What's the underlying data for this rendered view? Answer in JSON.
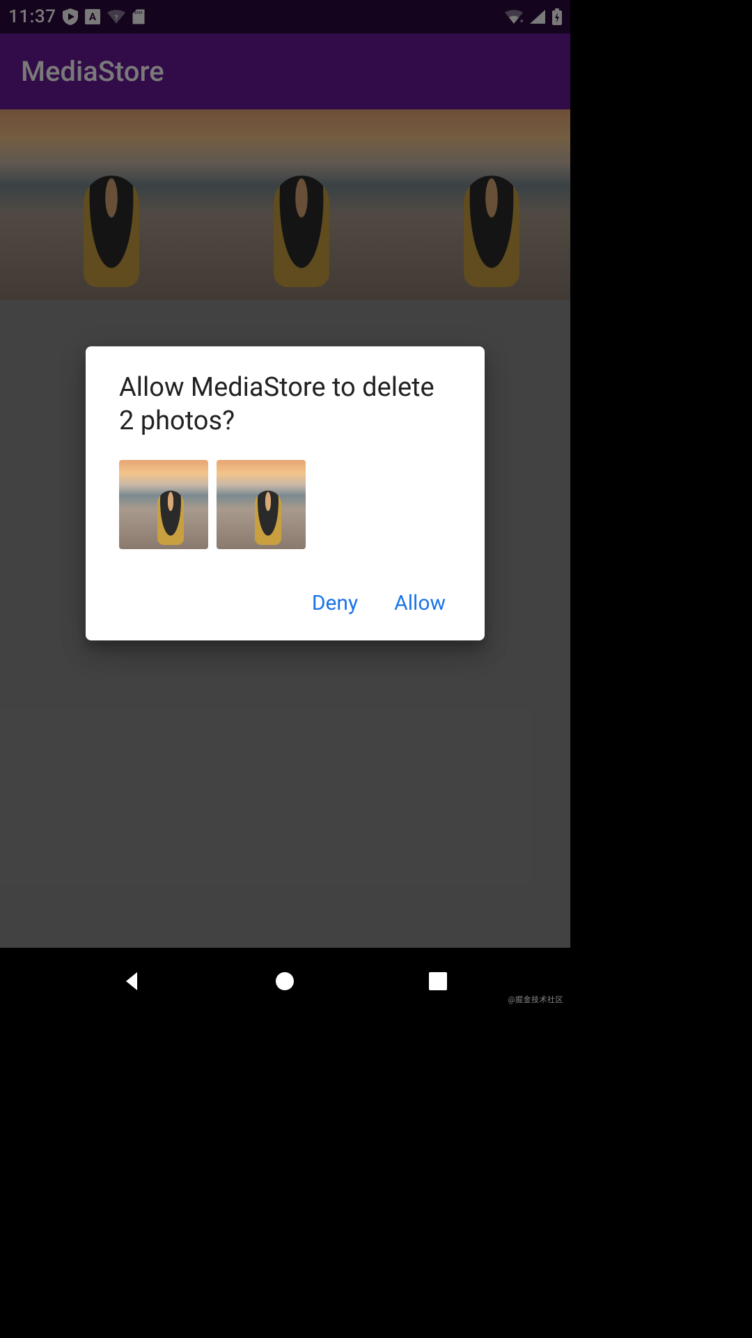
{
  "status": {
    "time": "11:37",
    "icons_left": [
      "shield-play",
      "language-A",
      "wifi-question",
      "sd-card"
    ],
    "icons_right": [
      "wifi-disconnected",
      "signal",
      "battery-charging"
    ]
  },
  "app": {
    "title": "MediaStore"
  },
  "gallery": {
    "count": 3
  },
  "dialog": {
    "title": "Allow MediaStore to delete 2 photos?",
    "thumb_count": 2,
    "deny": "Deny",
    "allow": "Allow"
  },
  "watermark": "@掘金技术社区"
}
